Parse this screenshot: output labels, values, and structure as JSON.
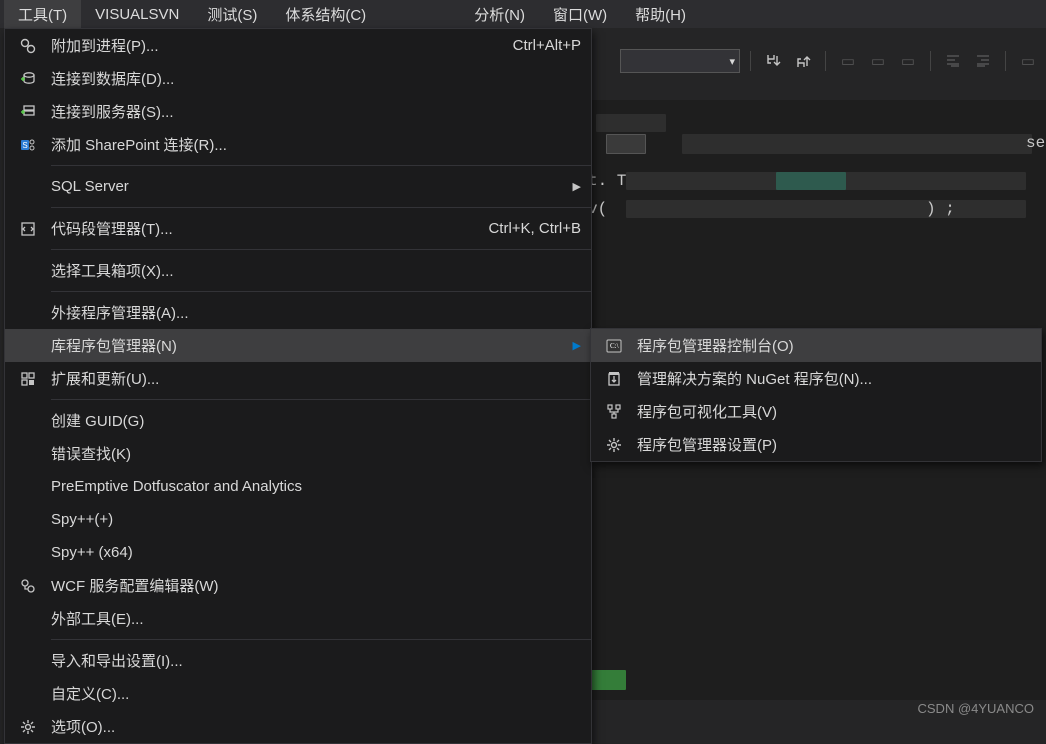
{
  "menubar": [
    {
      "label": "工具(T)",
      "sel": true
    },
    {
      "label": "VISUALSVN"
    },
    {
      "label": "测试(S)"
    },
    {
      "label": "体系结构(C)"
    },
    {
      "label": "",
      "dim": true,
      "w": 80
    },
    {
      "label": "分析(N)"
    },
    {
      "label": "窗口(W)"
    },
    {
      "label": "帮助(H)"
    }
  ],
  "tools_menu": [
    {
      "icon": "process-icon",
      "label": "附加到进程(P)...",
      "shortcut": "Ctrl+Alt+P"
    },
    {
      "icon": "db-connect-icon",
      "label": "连接到数据库(D)..."
    },
    {
      "icon": "server-connect-icon",
      "label": "连接到服务器(S)..."
    },
    {
      "icon": "sharepoint-icon",
      "label": "添加 SharePoint 连接(R)..."
    },
    {
      "sep": true
    },
    {
      "label": "SQL Server",
      "submenu": true
    },
    {
      "sep": true
    },
    {
      "icon": "snippet-icon",
      "label": "代码段管理器(T)...",
      "shortcut": "Ctrl+K, Ctrl+B"
    },
    {
      "sep": true
    },
    {
      "label": "选择工具箱项(X)..."
    },
    {
      "sep": true
    },
    {
      "label": "外接程序管理器(A)..."
    },
    {
      "label": "库程序包管理器(N)",
      "submenu": true,
      "hover": true
    },
    {
      "icon": "extensions-icon",
      "label": "扩展和更新(U)..."
    },
    {
      "sep": true
    },
    {
      "label": "创建 GUID(G)"
    },
    {
      "label": "错误查找(K)"
    },
    {
      "label": "PreEmptive Dotfuscator and Analytics"
    },
    {
      "label": "Spy++(+)"
    },
    {
      "label": "Spy++ (x64)"
    },
    {
      "icon": "wcf-icon",
      "label": "WCF 服务配置编辑器(W)"
    },
    {
      "label": "外部工具(E)..."
    },
    {
      "sep": true
    },
    {
      "label": "导入和导出设置(I)..."
    },
    {
      "label": "自定义(C)..."
    },
    {
      "icon": "gear-icon",
      "label": "选项(O)..."
    }
  ],
  "submenu": [
    {
      "icon": "console-icon",
      "label": "程序包管理器控制台(O)",
      "hover": true
    },
    {
      "icon": "package-icon",
      "label": "管理解决方案的 NuGet 程序包(N)..."
    },
    {
      "icon": "visualize-icon",
      "label": "程序包可视化工具(V)"
    },
    {
      "icon": "gear-icon",
      "label": "程序包管理器设置(P)"
    }
  ],
  "code_snips": {
    "a": "t. T",
    "b": "v(",
    "c": ") ;",
    "d": "se"
  },
  "watermark": "CSDN @4YUANCO"
}
